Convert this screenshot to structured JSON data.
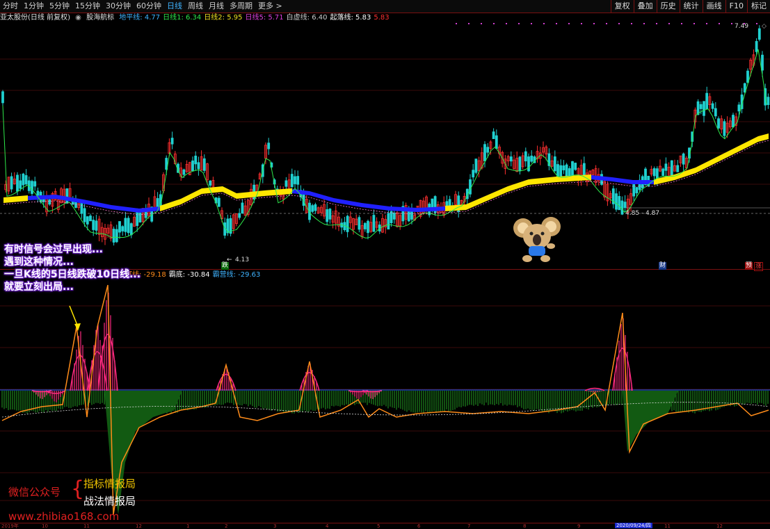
{
  "toolbar": {
    "periods": [
      "分时",
      "1分钟",
      "5分钟",
      "15分钟",
      "30分钟",
      "60分钟",
      "日线",
      "周线",
      "月线",
      "多周期",
      "更多 >"
    ],
    "active_index": 6,
    "right_buttons": [
      "复权",
      "叠加",
      "历史",
      "统计",
      "画线",
      "F10",
      "标记"
    ]
  },
  "infobar": {
    "stock": "亚太股份(日线 前复权)",
    "indicator": "股海航标",
    "items": [
      {
        "label": "地平线: 4.77",
        "color": "#3fb3ff"
      },
      {
        "label": "日线1: 6.34",
        "color": "#2ee84a"
      },
      {
        "label": "日线2: 5.95",
        "color": "#f0e020"
      },
      {
        "label": "日线5: 5.71",
        "color": "#e040e0"
      },
      {
        "label": "白虚线: 6.40",
        "color": "#cccccc"
      },
      {
        "label": "起落线: 5.83",
        "color": "#ffffff"
      },
      {
        "label": "5.83",
        "color": "#ff3030"
      }
    ]
  },
  "infobar2": {
    "items": [
      {
        "label": "天庭线: -29.18",
        "color": "#ff8c1a"
      },
      {
        "label": "霸底: -30.84",
        "color": "#ffffff"
      },
      {
        "label": "霸营线: -29.63",
        "color": "#3fb3ff"
      }
    ]
  },
  "price_labels": {
    "high": "7.49",
    "low_left": "4.13",
    "low_mid": "4.85 - 4.87"
  },
  "badges": {
    "die": "跌",
    "cai": "财",
    "yu": "预",
    "zhang": "涨"
  },
  "callout": {
    "lines": [
      "有时信号会过早出现...",
      "遇到这种情况...",
      "一旦K线的5日线跌破10日线...",
      "就要立刻出局..."
    ]
  },
  "watermark": {
    "wechat": "微信公众号",
    "brace": "{",
    "name1": "指标情报局",
    "name2": "战法情报局",
    "site": "www.zhibiao168.com"
  },
  "bottom_axis": {
    "labels": [
      "2019年",
      "10",
      "11",
      "12",
      "1",
      "2",
      "3",
      "4",
      "5",
      "6",
      "7",
      "8",
      "9",
      "11",
      "12"
    ],
    "highlight": "2020/09/24/四"
  },
  "colors": {
    "up": "#ff3030",
    "down": "#20d0d0",
    "yellow_band": "#ffe600",
    "blue_band": "#2020ff",
    "green_line": "#2ee84a",
    "orange_line": "#ff8c1a",
    "magenta": "#ff2a80",
    "green_hist": "#1f8a1f"
  }
}
